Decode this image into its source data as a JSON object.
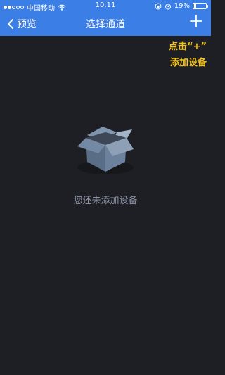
{
  "status_bar": {
    "carrier": "中国移动",
    "time": "10:11",
    "battery": "19%",
    "battery_level": 0.19
  },
  "navbar": {
    "back_label": "预览",
    "title": "选择通道"
  },
  "hint": {
    "line1": "点击“+”",
    "line2": "添加设备"
  },
  "empty_state": {
    "message": "您还未添加设备"
  },
  "colors": {
    "header": "#3b7ee6",
    "background": "#1e1f24",
    "hint": "#f3c318",
    "empty_text": "#8b93a6"
  }
}
